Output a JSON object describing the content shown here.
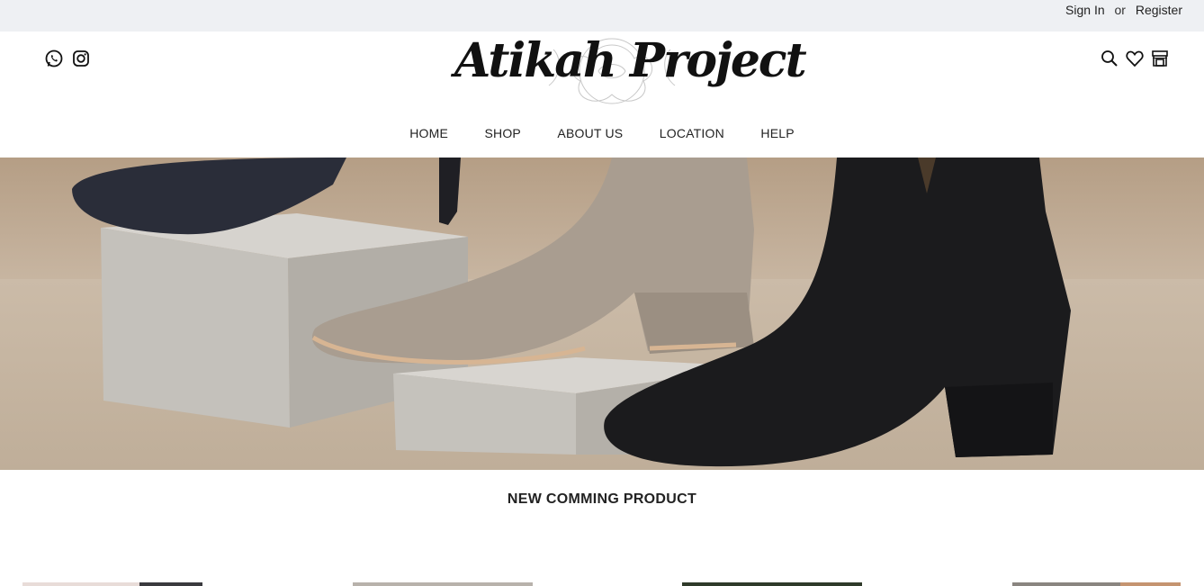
{
  "topbar": {
    "sign_in": "Sign In",
    "or": "or",
    "register": "Register"
  },
  "header": {
    "logo_text": "Atikah Project",
    "social_icons": [
      "whatsapp-icon",
      "instagram-icon"
    ],
    "action_icons": [
      "search-icon",
      "heart-icon",
      "store-icon"
    ]
  },
  "nav": {
    "items": [
      "HOME",
      "SHOP",
      "ABOUT US",
      "LOCATION",
      "HELP"
    ]
  },
  "hero": {
    "image_subject": "suede ankle boots on display blocks"
  },
  "section": {
    "title": "NEW COMMING PRODUCT"
  },
  "colors": {
    "topbar_bg": "#eef0f3",
    "hero_bg": "#c9b7a3",
    "text": "#222222"
  }
}
